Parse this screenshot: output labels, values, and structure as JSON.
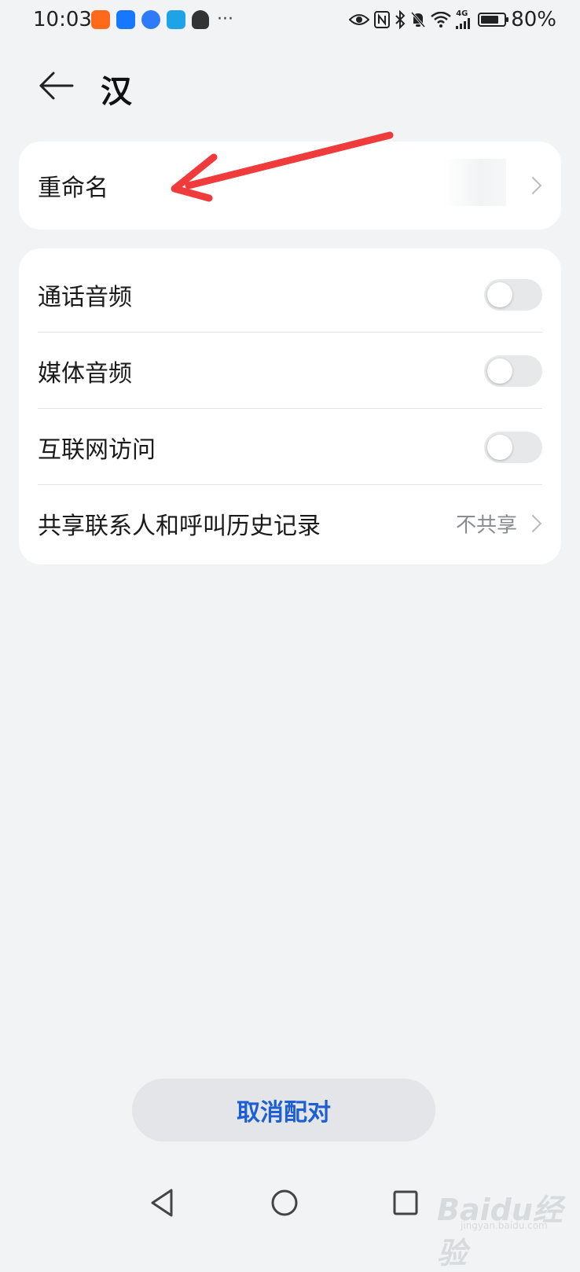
{
  "status_bar": {
    "time": "10:03",
    "more": "···",
    "network": "4G",
    "battery_text": "80%",
    "battery_level": 0.8,
    "app_icons": [
      "taobao-icon",
      "bird-app-icon",
      "circle-app-icon",
      "search-app-icon",
      "qq-icon"
    ],
    "status_icons": [
      "eye-icon",
      "nfc-icon",
      "bluetooth-icon",
      "mute-bell-icon",
      "wifi-icon",
      "signal-icon",
      "battery-icon"
    ]
  },
  "header": {
    "title": "汉",
    "back_icon": "arrow-left-icon"
  },
  "rename_card": {
    "label": "重命名"
  },
  "settings": {
    "call_audio": {
      "label": "通话音频",
      "on": false
    },
    "media_audio": {
      "label": "媒体音频",
      "on": false
    },
    "internet_access": {
      "label": "互联网访问",
      "on": false
    },
    "share_contacts": {
      "label": "共享联系人和呼叫历史记录",
      "value": "不共享"
    }
  },
  "unpair_button": {
    "label": "取消配对"
  },
  "nav_bar": {
    "icons": [
      "nav-back-icon",
      "nav-home-icon",
      "nav-recent-icon"
    ]
  },
  "watermark": {
    "text": "Baidu经验",
    "sub": "jingyan.baidu.com"
  },
  "colors": {
    "background": "#f1f3f5",
    "card": "#ffffff",
    "accent_blue": "#1d5fd3",
    "annotation_red": "#ef3b3b"
  }
}
